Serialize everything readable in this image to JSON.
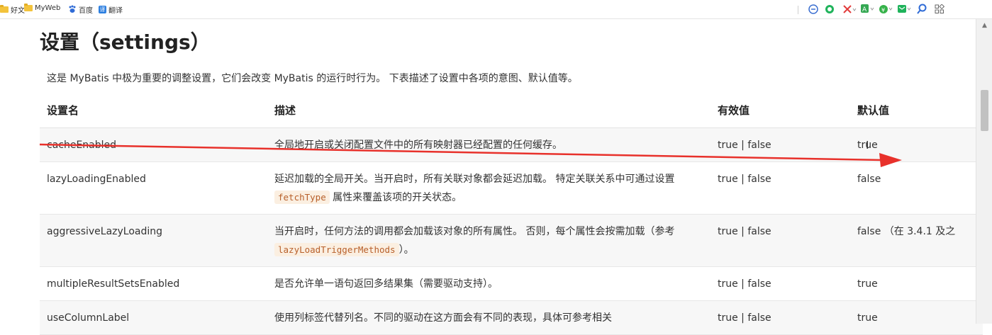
{
  "bookmarks": [
    {
      "label": "好文",
      "icon": "folder-icon"
    },
    {
      "label": "MyWeb",
      "icon": "folder-icon"
    },
    {
      "label": "百度",
      "icon": "baidu-paw-icon"
    },
    {
      "label": "翻译",
      "icon": "translate-icon"
    }
  ],
  "translate_glyph": "译",
  "toolbar_icons": [
    "minus-circle-icon",
    "chat-bubble-icon",
    "scissors-icon",
    "translate-addon-icon",
    "wallet-icon",
    "mail-icon",
    "search-icon",
    "grid-icon"
  ],
  "page": {
    "title": "设置（settings）",
    "intro": "这是 MyBatis 中极为重要的调整设置，它们会改变 MyBatis 的运行时行为。 下表描述了设置中各项的意图、默认值等。"
  },
  "table": {
    "headers": [
      "设置名",
      "描述",
      "有效值",
      "默认值"
    ],
    "rows": [
      {
        "name": "cacheEnabled",
        "desc": "全局地开启或关闭配置文件中的所有映射器已经配置的任何缓存。",
        "valid": "true | false",
        "default": "true"
      },
      {
        "name": "lazyLoadingEnabled",
        "desc_before": "延迟加载的全局开关。当开启时，所有关联对象都会延迟加载。 特定关联关系中可通过设置 ",
        "desc_code": "fetchType",
        "desc_after": " 属性来覆盖该项的开关状态。",
        "valid": "true | false",
        "default": "false"
      },
      {
        "name": "aggressiveLazyLoading",
        "desc_before": "当开启时，任何方法的调用都会加载该对象的所有属性。 否则，每个属性会按需加载（参考 ",
        "desc_code": "lazyLoadTriggerMethods",
        "desc_after": "）。",
        "valid": "true | false",
        "default": "false （在 3.4.1 及之"
      },
      {
        "name": "multipleResultSetsEnabled",
        "desc": "是否允许单一语句返回多结果集（需要驱动支持）。",
        "valid": "true | false",
        "default": "true"
      },
      {
        "name": "useColumnLabel",
        "desc": "使用列标签代替列名。不同的驱动在这方面会有不同的表现，具体可参考相关",
        "valid": "true | false",
        "default": "true"
      }
    ]
  },
  "annotation": {
    "color": "#e8312b"
  },
  "colors": {
    "accent": "#e8312b",
    "code_bg": "#fbefe1",
    "stripe": "#f7f7f7"
  }
}
